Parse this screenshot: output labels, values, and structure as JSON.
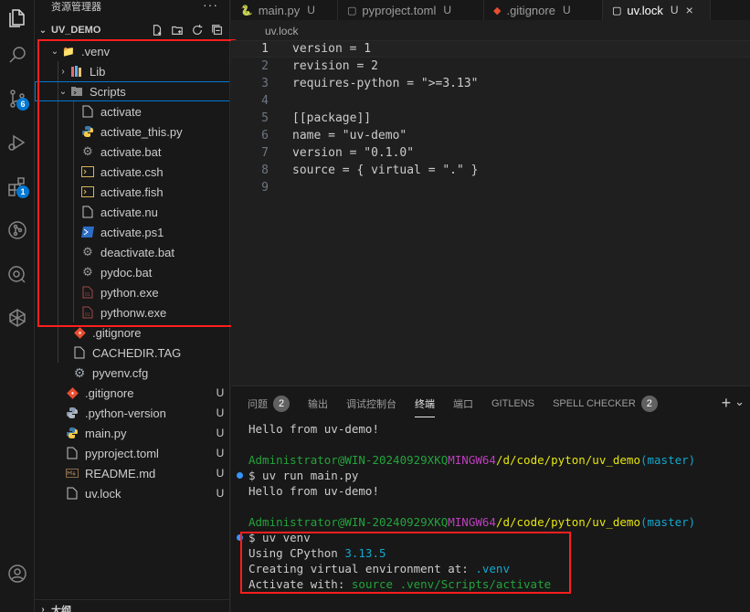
{
  "explorer": {
    "header": "资源管理器",
    "more": "···",
    "section_title": "UV_DEMO",
    "outline_title": "大纲"
  },
  "activity_badges": {
    "scm": "6",
    "extensions": "1"
  },
  "tree": [
    {
      "label": ".venv",
      "status": ""
    },
    {
      "label": "Lib",
      "status": ""
    },
    {
      "label": "Scripts",
      "status": ""
    },
    {
      "label": "activate",
      "status": ""
    },
    {
      "label": "activate_this.py",
      "status": ""
    },
    {
      "label": "activate.bat",
      "status": ""
    },
    {
      "label": "activate.csh",
      "status": ""
    },
    {
      "label": "activate.fish",
      "status": ""
    },
    {
      "label": "activate.nu",
      "status": ""
    },
    {
      "label": "activate.ps1",
      "status": ""
    },
    {
      "label": "deactivate.bat",
      "status": ""
    },
    {
      "label": "pydoc.bat",
      "status": ""
    },
    {
      "label": "python.exe",
      "status": ""
    },
    {
      "label": "pythonw.exe",
      "status": ""
    },
    {
      "label": ".gitignore",
      "status": ""
    },
    {
      "label": "CACHEDIR.TAG",
      "status": ""
    },
    {
      "label": "pyvenv.cfg",
      "status": ""
    },
    {
      "label": ".gitignore",
      "status": "U"
    },
    {
      "label": ".python-version",
      "status": "U"
    },
    {
      "label": "main.py",
      "status": "U"
    },
    {
      "label": "pyproject.toml",
      "status": "U"
    },
    {
      "label": "README.md",
      "status": "U"
    },
    {
      "label": "uv.lock",
      "status": "U"
    }
  ],
  "tabs": [
    {
      "label": "main.py",
      "status": "U"
    },
    {
      "label": "pyproject.toml",
      "status": "U"
    },
    {
      "label": ".gitignore",
      "status": "U"
    },
    {
      "label": "uv.lock",
      "status": "U",
      "close": "×"
    }
  ],
  "breadcrumb": "uv.lock",
  "editor": {
    "lines": [
      {
        "n": "1",
        "text": "version = 1"
      },
      {
        "n": "2",
        "text": "revision = 2"
      },
      {
        "n": "3",
        "text": "requires-python = \">=3.13\""
      },
      {
        "n": "4",
        "text": ""
      },
      {
        "n": "5",
        "text": "[[package]]"
      },
      {
        "n": "6",
        "text": "name = \"uv-demo\""
      },
      {
        "n": "7",
        "text": "version = \"0.1.0\""
      },
      {
        "n": "8",
        "text": "source = { virtual = \".\" }"
      },
      {
        "n": "9",
        "text": ""
      }
    ]
  },
  "panel": {
    "tabs": [
      {
        "label": "问题",
        "badge": "2"
      },
      {
        "label": "输出",
        "badge": ""
      },
      {
        "label": "调试控制台",
        "badge": ""
      },
      {
        "label": "终端",
        "badge": ""
      },
      {
        "label": "端口",
        "badge": ""
      },
      {
        "label": "GITLENS",
        "badge": ""
      },
      {
        "label": "SPELL CHECKER",
        "badge": "2"
      }
    ],
    "add": "+",
    "dropdown": "⌄"
  },
  "terminal": {
    "hello1": "Hello from uv-demo!",
    "prompt1": {
      "user": "Administrator@WIN-20240929XKQ",
      "shell": "MINGW64",
      "path": "/d/code/pyton/uv_demo",
      "branch": "(master)"
    },
    "cmd1": "$ uv run main.py",
    "hello2": "Hello from uv-demo!",
    "prompt2": {
      "user": "Administrator@WIN-20240929XKQ",
      "shell": "MINGW64",
      "path": "/d/code/pyton/uv_demo",
      "branch": "(master)"
    },
    "cmd2": "$ uv venv",
    "using_label": "Using CPython ",
    "using_version": "3.13.5",
    "creating_label": "Creating virtual environment at: ",
    "creating_path": ".venv",
    "activate_label": "Activate with: ",
    "activate_cmd": "source .venv/Scripts/activate"
  },
  "colors": {
    "accent": "#0078d4",
    "highlight_box": "#ff1f1f",
    "terminal_green": "#23a33b",
    "terminal_magenta": "#bc3fbc",
    "terminal_yellow": "#e5e510",
    "terminal_cyan": "#11a8cd"
  }
}
